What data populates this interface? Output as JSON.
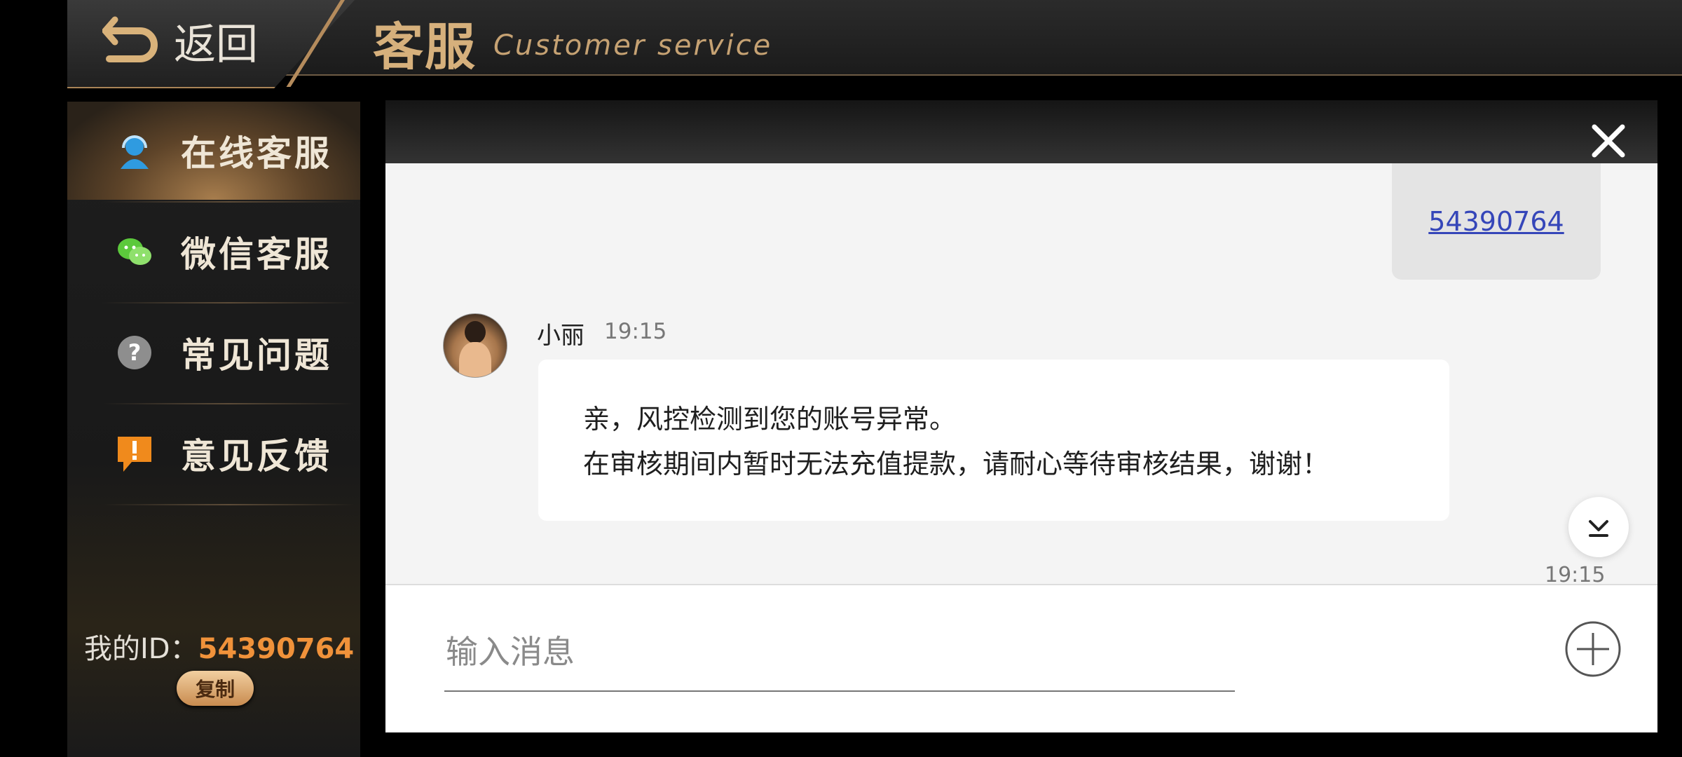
{
  "header": {
    "back_label": "返回",
    "title_cn": "客服",
    "title_en": "Customer service"
  },
  "sidebar": {
    "items": [
      {
        "label": "在线客服",
        "icon": "headset-person-icon",
        "active": true
      },
      {
        "label": "微信客服",
        "icon": "wechat-icon",
        "active": false
      },
      {
        "label": "常见问题",
        "icon": "question-icon",
        "active": false
      },
      {
        "label": "意见反馈",
        "icon": "feedback-exclamation-icon",
        "active": false
      }
    ],
    "my_id_label": "我的ID：",
    "my_id_value": "54390764",
    "copy_label": "复制"
  },
  "chat": {
    "my_message": "54390764",
    "agent": {
      "name": "小丽",
      "time": "19:15"
    },
    "agent_message_lines": [
      "亲，风控检测到您的账号异常。",
      "在审核期间内暂时无法充值提款，请耐心等待审核结果，谢谢！"
    ],
    "next_time": "19:15",
    "input_placeholder": "输入消息"
  },
  "colors": {
    "accent_gold": "#d6b07c",
    "id_orange": "#f0923a",
    "link_blue": "#3546b9"
  }
}
